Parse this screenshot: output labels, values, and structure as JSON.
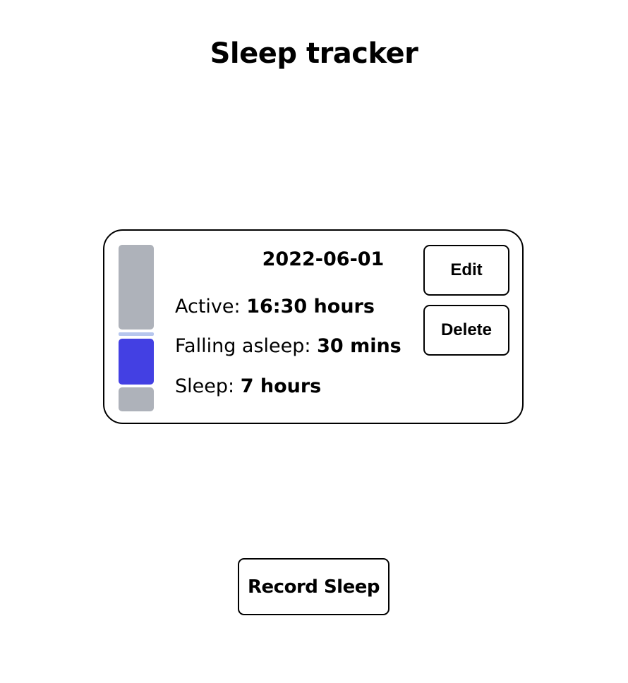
{
  "page": {
    "title": "Sleep tracker"
  },
  "entry": {
    "date": "2022-06-01",
    "stats": [
      {
        "label": "Active: ",
        "value": "16:30 hours"
      },
      {
        "label": "Falling asleep: ",
        "value": "30 mins"
      },
      {
        "label": "Sleep: ",
        "value": "7 hours"
      }
    ],
    "timeline_segments": [
      {
        "name": "active",
        "hours": 16.5,
        "color": "#aeb2ba"
      },
      {
        "name": "falling-asleep",
        "hours": 0.5,
        "color": "#b6c6ee"
      },
      {
        "name": "sleep",
        "hours": 7,
        "color": "#4340e3"
      },
      {
        "name": "remaining",
        "hours": 2.5,
        "color": "#aeb2ba"
      }
    ],
    "edit_label": "Edit",
    "delete_label": "Delete"
  },
  "actions": {
    "record_label": "Record Sleep"
  }
}
